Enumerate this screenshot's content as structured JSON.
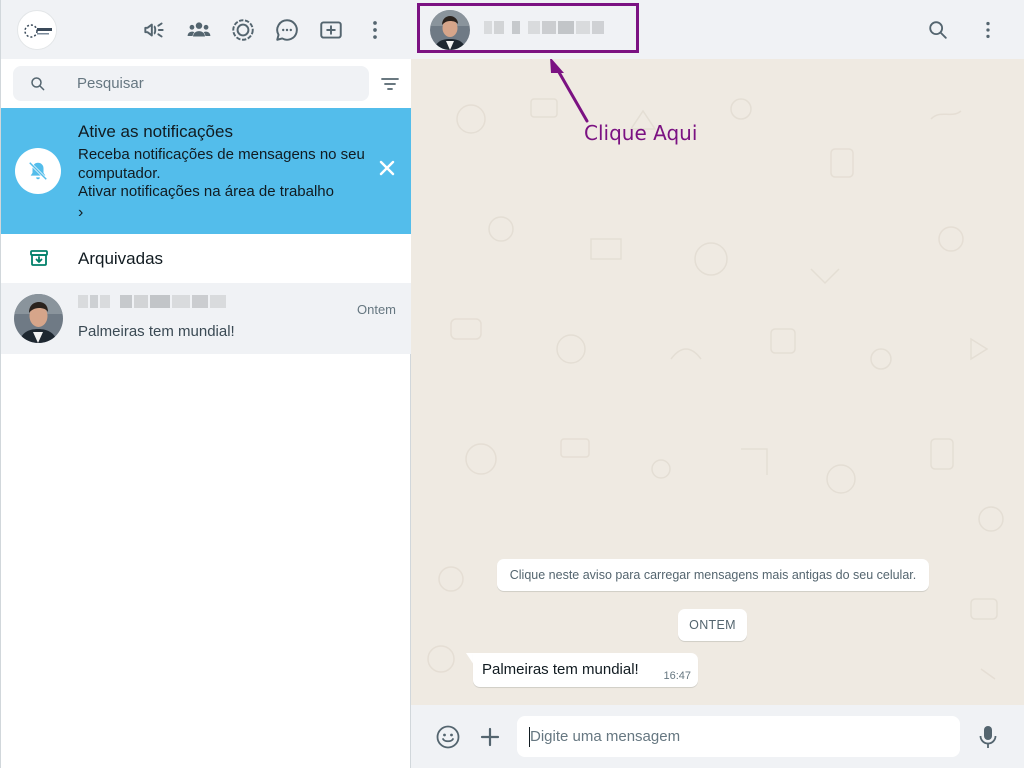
{
  "header": {
    "icons": [
      "channels-icon",
      "communities-icon",
      "status-icon",
      "chat-bubble-icon",
      "new-chat-icon",
      "menu-icon"
    ]
  },
  "search": {
    "placeholder": "Pesquisar"
  },
  "notification": {
    "title": "Ative as notificações",
    "text": "Receba notificações de mensagens no seu computador.",
    "link": "Ativar notificações na área de trabalho",
    "chevron": "›"
  },
  "archived": {
    "label": "Arquivadas"
  },
  "chat_list": [
    {
      "time": "Ontem",
      "last_message": "Palmeiras tem mundial!"
    }
  ],
  "annotation": {
    "text": "Clique Aqui",
    "color": "#7b1282"
  },
  "conversation": {
    "system_notice": "Clique neste aviso para carregar mensagens mais antigas do seu celular.",
    "date_chip": "ONTEM",
    "messages": [
      {
        "text": "Palmeiras tem mundial!",
        "time": "16:47"
      }
    ]
  },
  "composer": {
    "placeholder": "Digite uma mensagem"
  },
  "colors": {
    "notification_bg": "#53bdeb",
    "panel_header_bg": "#f0f2f5",
    "chat_bg": "#efeae2",
    "accent_green": "#008069"
  }
}
